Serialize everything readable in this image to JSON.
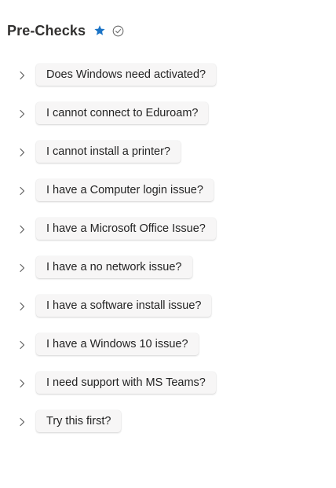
{
  "header": {
    "title": "Pre-Checks",
    "star_icon": "star-icon",
    "verified_icon": "check-circle-icon",
    "accent_color": "#1a73c6"
  },
  "items": [
    {
      "label": "Does Windows need activated?"
    },
    {
      "label": "I cannot connect to Eduroam?"
    },
    {
      "label": "I cannot install a printer?"
    },
    {
      "label": "I have a Computer login issue?"
    },
    {
      "label": "I have a Microsoft Office Issue?"
    },
    {
      "label": "I have a no network issue?"
    },
    {
      "label": "I have a software install issue?"
    },
    {
      "label": "I have a Windows 10 issue?"
    },
    {
      "label": "I need support with MS Teams?"
    },
    {
      "label": "Try this first?"
    }
  ]
}
